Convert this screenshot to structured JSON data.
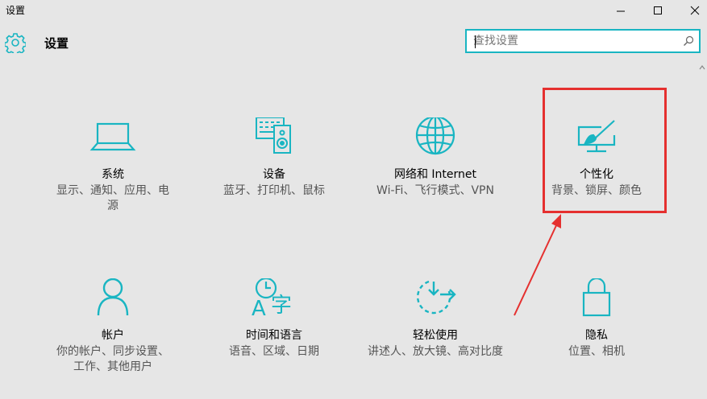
{
  "window": {
    "title": "设置",
    "minimize_icon": "minimize-icon",
    "maximize_icon": "maximize-icon",
    "close_icon": "close-icon"
  },
  "header": {
    "icon": "gear-icon",
    "title": "设置"
  },
  "search": {
    "placeholder": "查找设置",
    "value": "",
    "icon": "search-icon"
  },
  "accent_color": "#19b5c2",
  "highlight_color": "#e5302f",
  "tiles": [
    {
      "name": "系统",
      "desc": "显示、通知、应用、电源",
      "icon": "laptop-icon"
    },
    {
      "name": "设备",
      "desc": "蓝牙、打印机、鼠标",
      "icon": "devices-icon"
    },
    {
      "name": "网络和 Internet",
      "desc": "Wi-Fi、飞行模式、VPN",
      "icon": "globe-icon"
    },
    {
      "name": "个性化",
      "desc": "背景、锁屏、颜色",
      "icon": "personalization-icon"
    },
    {
      "name": "帐户",
      "desc": "你的帐户、同步设置、工作、其他用户",
      "icon": "person-icon"
    },
    {
      "name": "时间和语言",
      "desc": "语音、区域、日期",
      "icon": "time-language-icon"
    },
    {
      "name": "轻松使用",
      "desc": "讲述人、放大镜、高对比度",
      "icon": "ease-of-access-icon"
    },
    {
      "name": "隐私",
      "desc": "位置、相机",
      "icon": "lock-icon"
    }
  ]
}
